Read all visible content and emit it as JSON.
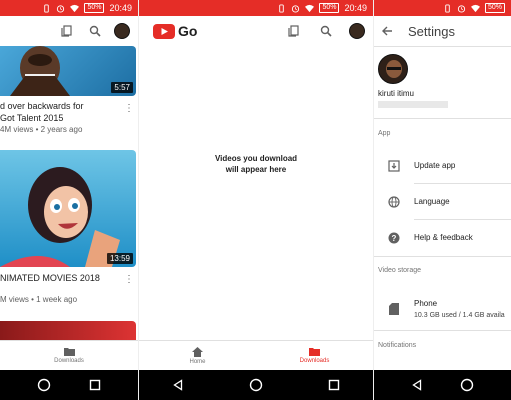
{
  "status": {
    "battery": "50%",
    "time": "20:49"
  },
  "feed": {
    "items": [
      {
        "title_line1": "d over backwards for",
        "title_line2": "Got Talent 2015",
        "meta": "4M views • 2 years ago",
        "duration": "5:57"
      },
      {
        "title_line1": "NIMATED MOVIES 2018",
        "meta": "M views • 1 week ago",
        "duration": "13:59"
      }
    ],
    "bottom_nav": {
      "downloads": "Downloads"
    }
  },
  "go": {
    "logo_text": "Go",
    "empty_line1": "Videos you download",
    "empty_line2": "will appear here",
    "bottom_nav": {
      "home": "Home",
      "downloads": "Downloads"
    }
  },
  "settings": {
    "title": "Settings",
    "user_name": "kiruti itimu",
    "section_app": "App",
    "update_app": "Update app",
    "language": "Language",
    "help": "Help & feedback",
    "section_storage": "Video storage",
    "phone_label": "Phone",
    "phone_usage": "10.3 GB used / 1.4 GB availa",
    "section_notifications": "Notifications"
  },
  "colors": {
    "brand_red": "#e52d27"
  }
}
